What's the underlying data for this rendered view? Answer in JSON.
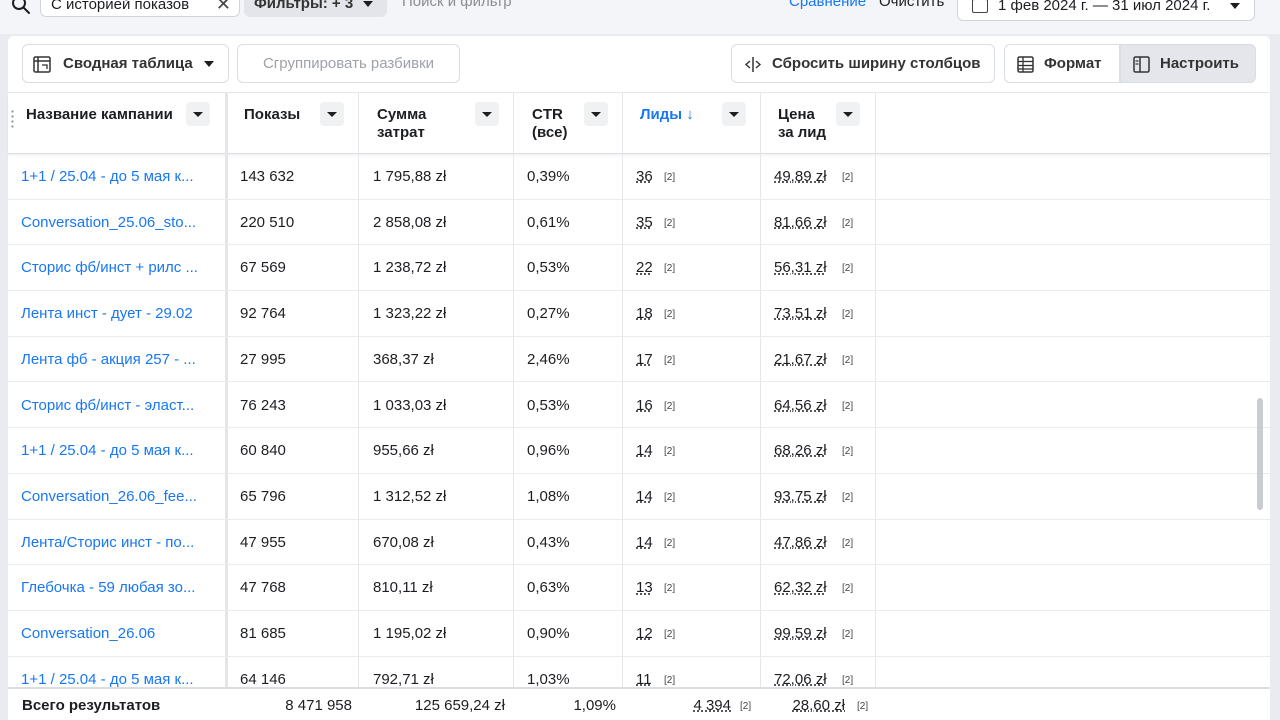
{
  "topbar": {
    "history_chip": "С историей показов",
    "filters_chip": "Фильтры: + 3",
    "search_hint": "Поиск и фильтр",
    "compare": "Сравнение",
    "clear": "Очистить",
    "date_range": "1 фев 2024 г. — 31 июл 2024 г."
  },
  "toolbar": {
    "pivot": "Сводная таблица",
    "group_breakdowns": "Сгруппировать разбивки",
    "reset_widths": "Сбросить ширину столбцов",
    "format": "Формат",
    "customize": "Настроить"
  },
  "columns": {
    "name": "Название кампании",
    "impressions": "Показы",
    "spend_1": "Сумма",
    "spend_2": "затрат",
    "ctr_1": "CTR",
    "ctr_2": "(все)",
    "leads": "Лиды ↓",
    "cpl_1": "Цена",
    "cpl_2": "за лид"
  },
  "rows": [
    {
      "name": "1+1 / 25.04 - до 5 мая к...",
      "impressions": "143 632",
      "spend": "1 795,88 zł",
      "ctr": "0,39%",
      "leads": "36",
      "leads_ref": "[2]",
      "cpl": "49,89 zł",
      "cpl_ref": "[2]"
    },
    {
      "name": "Conversation_25.06_sto...",
      "impressions": "220 510",
      "spend": "2 858,08 zł",
      "ctr": "0,61%",
      "leads": "35",
      "leads_ref": "[2]",
      "cpl": "81,66 zł",
      "cpl_ref": "[2]"
    },
    {
      "name": "Сторис фб/инст + рилс ...",
      "impressions": "67 569",
      "spend": "1 238,72 zł",
      "ctr": "0,53%",
      "leads": "22",
      "leads_ref": "[2]",
      "cpl": "56,31 zł",
      "cpl_ref": "[2]"
    },
    {
      "name": "Лента инст - дует - 29.02",
      "impressions": "92 764",
      "spend": "1 323,22 zł",
      "ctr": "0,27%",
      "leads": "18",
      "leads_ref": "[2]",
      "cpl": "73,51 zł",
      "cpl_ref": "[2]"
    },
    {
      "name": "Лента фб - акция 257 - ...",
      "impressions": "27 995",
      "spend": "368,37 zł",
      "ctr": "2,46%",
      "leads": "17",
      "leads_ref": "[2]",
      "cpl": "21,67 zł",
      "cpl_ref": "[2]"
    },
    {
      "name": "Сторис фб/инст - эласт...",
      "impressions": "76 243",
      "spend": "1 033,03 zł",
      "ctr": "0,53%",
      "leads": "16",
      "leads_ref": "[2]",
      "cpl": "64,56 zł",
      "cpl_ref": "[2]"
    },
    {
      "name": "1+1 / 25.04 - до 5 мая к...",
      "impressions": "60 840",
      "spend": "955,66 zł",
      "ctr": "0,96%",
      "leads": "14",
      "leads_ref": "[2]",
      "cpl": "68,26 zł",
      "cpl_ref": "[2]"
    },
    {
      "name": "Conversation_26.06_fee...",
      "impressions": "65 796",
      "spend": "1 312,52 zł",
      "ctr": "1,08%",
      "leads": "14",
      "leads_ref": "[2]",
      "cpl": "93,75 zł",
      "cpl_ref": "[2]"
    },
    {
      "name": "Лента/Сторис инст - по...",
      "impressions": "47 955",
      "spend": "670,08 zł",
      "ctr": "0,43%",
      "leads": "14",
      "leads_ref": "[2]",
      "cpl": "47,86 zł",
      "cpl_ref": "[2]"
    },
    {
      "name": "Глебочка - 59 любая зо...",
      "impressions": "47 768",
      "spend": "810,11 zł",
      "ctr": "0,63%",
      "leads": "13",
      "leads_ref": "[2]",
      "cpl": "62,32 zł",
      "cpl_ref": "[2]"
    },
    {
      "name": "Conversation_26.06",
      "impressions": "81 685",
      "spend": "1 195,02 zł",
      "ctr": "0,90%",
      "leads": "12",
      "leads_ref": "[2]",
      "cpl": "99,59 zł",
      "cpl_ref": "[2]"
    },
    {
      "name": "1+1 / 25.04 - до 5 мая к...",
      "impressions": "64 146",
      "spend": "792,71 zł",
      "ctr": "1,03%",
      "leads": "11",
      "leads_ref": "[2]",
      "cpl": "72,06 zł",
      "cpl_ref": "[2]"
    }
  ],
  "totals": {
    "label": "Всего результатов",
    "impressions": "8 471 958",
    "spend": "125 659,24 zł",
    "ctr": "1,09%",
    "leads": "4 394",
    "leads_ref": "[2]",
    "cpl": "28,60 zł",
    "cpl_ref": "[2]"
  }
}
